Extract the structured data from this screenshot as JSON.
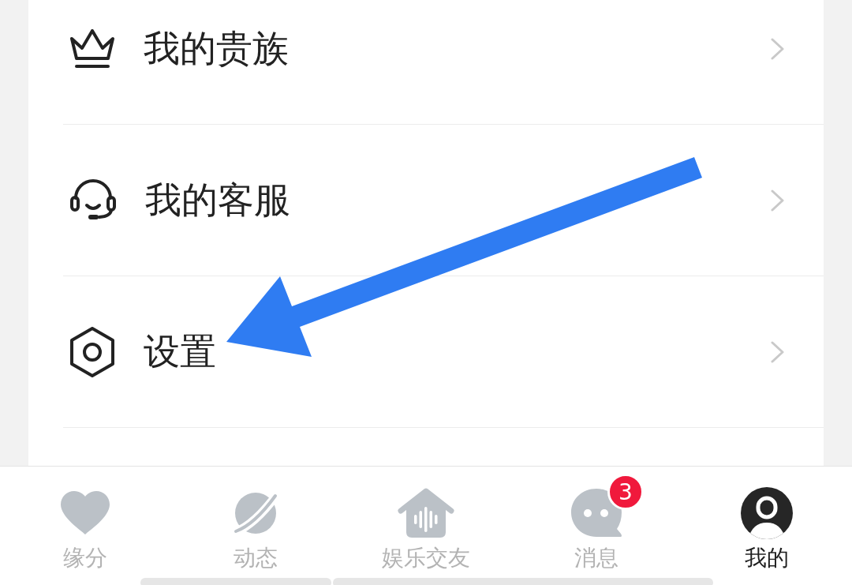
{
  "menu": {
    "items": [
      {
        "label": "我的贵族"
      },
      {
        "label": "我的客服"
      },
      {
        "label": "设置"
      }
    ]
  },
  "tab_bar": {
    "tabs": [
      {
        "label": "缘分",
        "selected": false
      },
      {
        "label": "动态",
        "selected": false
      },
      {
        "label": "娱乐交友",
        "selected": false
      },
      {
        "label": "消息",
        "selected": false,
        "badge": "3"
      },
      {
        "label": "我的",
        "selected": true
      }
    ]
  }
}
